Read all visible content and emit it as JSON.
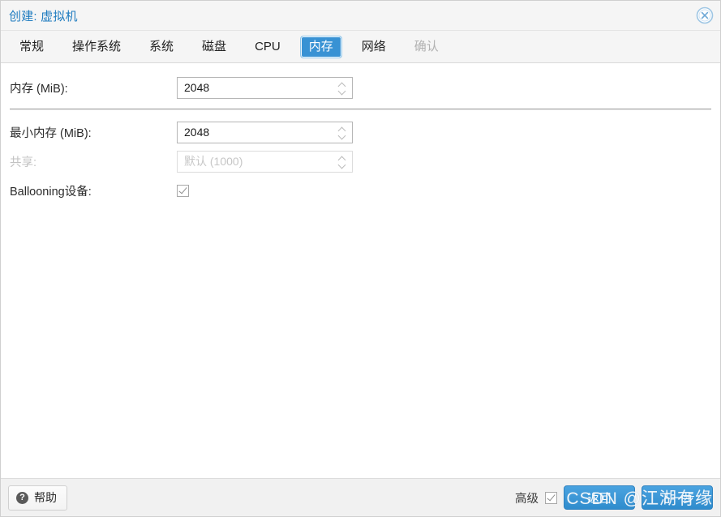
{
  "window": {
    "title": "创建: 虚拟机",
    "close_icon": "close-circle-icon"
  },
  "tabs": [
    {
      "label": "常规",
      "state": "normal"
    },
    {
      "label": "操作系统",
      "state": "normal"
    },
    {
      "label": "系统",
      "state": "normal"
    },
    {
      "label": "磁盘",
      "state": "normal"
    },
    {
      "label": "CPU",
      "state": "normal"
    },
    {
      "label": "内存",
      "state": "active"
    },
    {
      "label": "网络",
      "state": "normal"
    },
    {
      "label": "确认",
      "state": "disabled"
    }
  ],
  "form": {
    "memory": {
      "label": "内存 (MiB):",
      "value": "2048"
    },
    "min_memory": {
      "label": "最小内存 (MiB):",
      "value": "2048"
    },
    "shares": {
      "label": "共享:",
      "placeholder": "默认 (1000)",
      "value": "默认 (1000)",
      "disabled": true
    },
    "ballooning": {
      "label": "Ballooning设备:",
      "checked": true
    }
  },
  "footer": {
    "help_label": "帮助",
    "help_icon": "question-circle-icon",
    "advanced_label": "高级",
    "advanced_checked": true,
    "back_label": "返回",
    "next_label": "下一步"
  },
  "watermark": {
    "text": "CSDN @江湖有缘"
  },
  "colors": {
    "accent": "#3892d4",
    "title": "#1f7cc0",
    "panel_bg": "#f5f5f5",
    "footer_bg": "#f1f1f1",
    "text": "#2b2b2b",
    "disabled_text": "#c2c2c2"
  }
}
